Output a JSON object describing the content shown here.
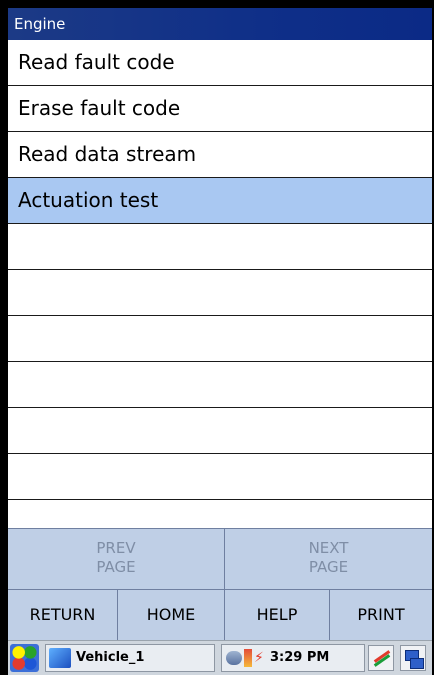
{
  "window": {
    "title": "Engine"
  },
  "menu": {
    "items": [
      {
        "label": "Read fault code",
        "selected": false
      },
      {
        "label": "Erase fault code",
        "selected": false
      },
      {
        "label": "Read data stream",
        "selected": false
      },
      {
        "label": "Actuation test",
        "selected": true
      },
      {
        "label": ""
      },
      {
        "label": ""
      },
      {
        "label": ""
      },
      {
        "label": ""
      },
      {
        "label": ""
      },
      {
        "label": ""
      }
    ]
  },
  "nav": {
    "prev_line1": "PREV",
    "prev_line2": "PAGE",
    "next_line1": "NEXT",
    "next_line2": "PAGE"
  },
  "buttons": {
    "return": "RETURN",
    "home": "HOME",
    "help": "HELP",
    "print": "PRINT"
  },
  "taskbar": {
    "task": "Vehicle_1",
    "clock": "3:29 PM"
  },
  "icons": [
    "start-icon",
    "vehicle-task-icon",
    "network-icon",
    "battery-icon",
    "power-icon",
    "connection-icon",
    "windows-icon"
  ]
}
